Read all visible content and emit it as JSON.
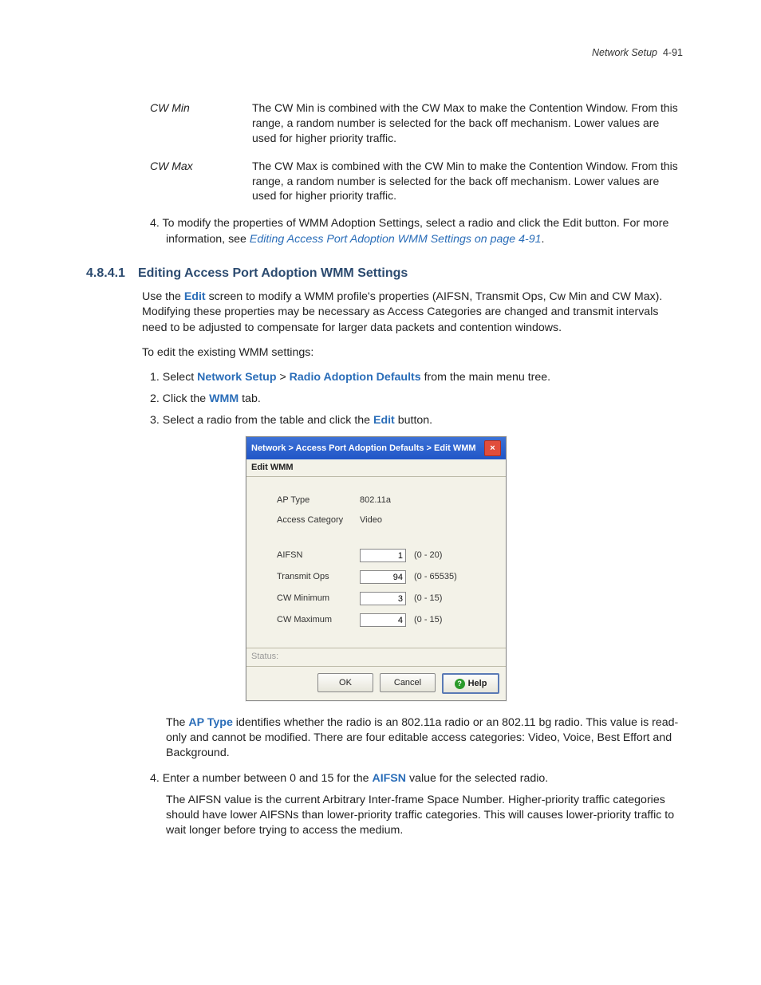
{
  "header": {
    "section_name": "Network Setup",
    "page_ref": "4-91"
  },
  "definitions": [
    {
      "term": "CW Min",
      "desc": "The CW Min is combined with the CW Max to make the Contention Window. From this range, a random number is selected for the back off mechanism. Lower values are used for higher priority traffic."
    },
    {
      "term": "CW Max",
      "desc": "The CW Max is combined with the CW Min to make the Contention Window. From this range, a random number is selected for the back off mechanism. Lower values are used for higher priority traffic."
    }
  ],
  "step4": {
    "num": "4.",
    "text_a": "To modify the properties of WMM Adoption Settings, select a radio and click the Edit button. For more information, see ",
    "link": "Editing Access Port Adoption WMM Settings on page 4-91",
    "text_b": "."
  },
  "section": {
    "number": "4.8.4.1",
    "title": "Editing Access Port Adoption WMM Settings"
  },
  "intro": {
    "a": "Use the ",
    "b": "Edit",
    "c": " screen to modify a WMM profile's properties (AIFSN, Transmit Ops, Cw Min and CW Max). Modifying these properties may be necessary as Access Categories are changed and transmit intervals need to be adjusted to compensate for larger data packets and contention windows."
  },
  "lead": "To edit the existing WMM settings:",
  "steps": {
    "s1": {
      "num": "1.",
      "a": "Select ",
      "b": "Network Setup",
      "sep": " > ",
      "c": "Radio Adoption Defaults",
      "d": " from the main menu tree."
    },
    "s2": {
      "num": "2.",
      "a": "Click the ",
      "b": "WMM",
      "c": " tab."
    },
    "s3": {
      "num": "3.",
      "a": "Select a radio from the table and click the ",
      "b": "Edit",
      "c": " button."
    }
  },
  "dialog": {
    "title": "Network > Access Port Adoption Defaults > Edit WMM",
    "subtitle": "Edit WMM",
    "labels": {
      "ap_type": "AP Type",
      "access_category": "Access Category",
      "aifsn": "AIFSN",
      "transmit_ops": "Transmit Ops",
      "cw_min": "CW Minimum",
      "cw_max": "CW Maximum",
      "status": "Status:"
    },
    "values": {
      "ap_type": "802.11a",
      "access_category": "Video",
      "aifsn": "1",
      "transmit_ops": "94",
      "cw_min": "3",
      "cw_max": "4"
    },
    "ranges": {
      "aifsn": "(0 - 20)",
      "transmit_ops": "(0 - 65535)",
      "cw_min": "(0 - 15)",
      "cw_max": "(0 - 15)"
    },
    "buttons": {
      "ok": "OK",
      "cancel": "Cancel",
      "help": "Help"
    }
  },
  "after": {
    "p1a": "The ",
    "p1b": "AP Type",
    "p1c": " identifies whether the radio is an 802.11a radio or an 802.11 bg radio. This value is read-only and cannot be modified. There are four editable access categories: Video, Voice, Best Effort and Background.",
    "s4num": "4.",
    "s4a": "Enter a number between 0 and 15 for the ",
    "s4b": "AIFSN",
    "s4c": " value for the selected radio.",
    "p2": "The AIFSN value is the current Arbitrary Inter-frame Space Number. Higher-priority traffic categories should have lower AIFSNs than lower-priority traffic categories. This will causes lower-priority traffic to wait longer before trying to access the medium."
  }
}
